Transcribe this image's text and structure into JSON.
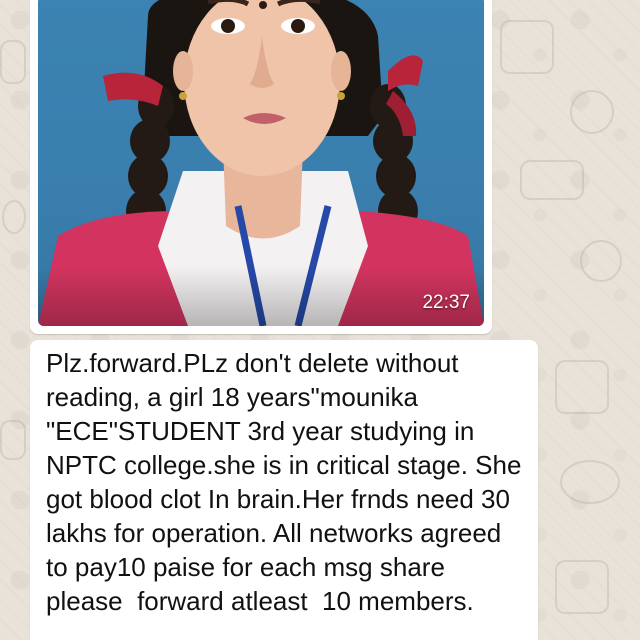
{
  "conversation": {
    "image_message": {
      "timestamp": "22:37",
      "image_alt": "Photo of a girl in school uniform with braided hair and red ribbons"
    },
    "text_message": {
      "text": "Plz.forward.PLz don't delete without reading, a girl 18 years\"mounika \"ECE\"STUDENT 3rd year studying in NPTC college.she is in critical stage. She got blood clot In brain.Her frnds need 30 lakhs for operation. All networks agreed to pay10 paise for each msg share please  forward atleast  10 members."
    }
  },
  "colors": {
    "wallpaper": "#e8e2d8",
    "bubble": "#ffffff",
    "text": "#111111",
    "photo_background": "#3a7fae"
  }
}
